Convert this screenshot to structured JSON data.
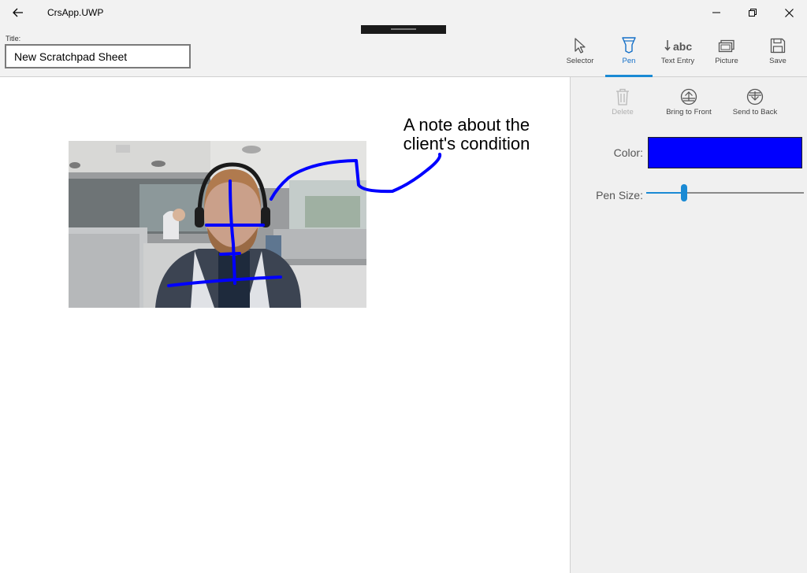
{
  "window": {
    "app_title": "CrsApp.UWP",
    "back_icon": "back-arrow-icon",
    "minimize_icon": "minimize-icon",
    "restore_icon": "restore-icon",
    "close_icon": "close-icon"
  },
  "header": {
    "title_label": "Title:",
    "title_value": "New Scratchpad Sheet"
  },
  "toolbar": {
    "active_tool": "Pen",
    "accent_color": "#1a8ad4",
    "tools": [
      {
        "label": "Selector",
        "icon": "cursor-arrow-icon"
      },
      {
        "label": "Pen",
        "icon": "pen-icon"
      },
      {
        "label": "Text Entry",
        "icon": "text-entry-icon"
      },
      {
        "label": "Picture",
        "icon": "picture-icon"
      },
      {
        "label": "Save",
        "icon": "save-icon"
      }
    ]
  },
  "canvas": {
    "note_line1": "A note about the",
    "note_line2": "client's condition",
    "ink_color": "#0000ff",
    "photo_description_icon": "photo-image"
  },
  "panel": {
    "actions": [
      {
        "label": "Delete",
        "icon": "trash-icon",
        "enabled": false
      },
      {
        "label": "Bring to Front",
        "icon": "bring-to-front-icon",
        "enabled": true
      },
      {
        "label": "Send to Back",
        "icon": "send-to-back-icon",
        "enabled": true
      }
    ],
    "color_label": "Color:",
    "color_value": "#0000ff",
    "pen_size_label": "Pen Size:",
    "pen_size_fraction": 0.24
  }
}
